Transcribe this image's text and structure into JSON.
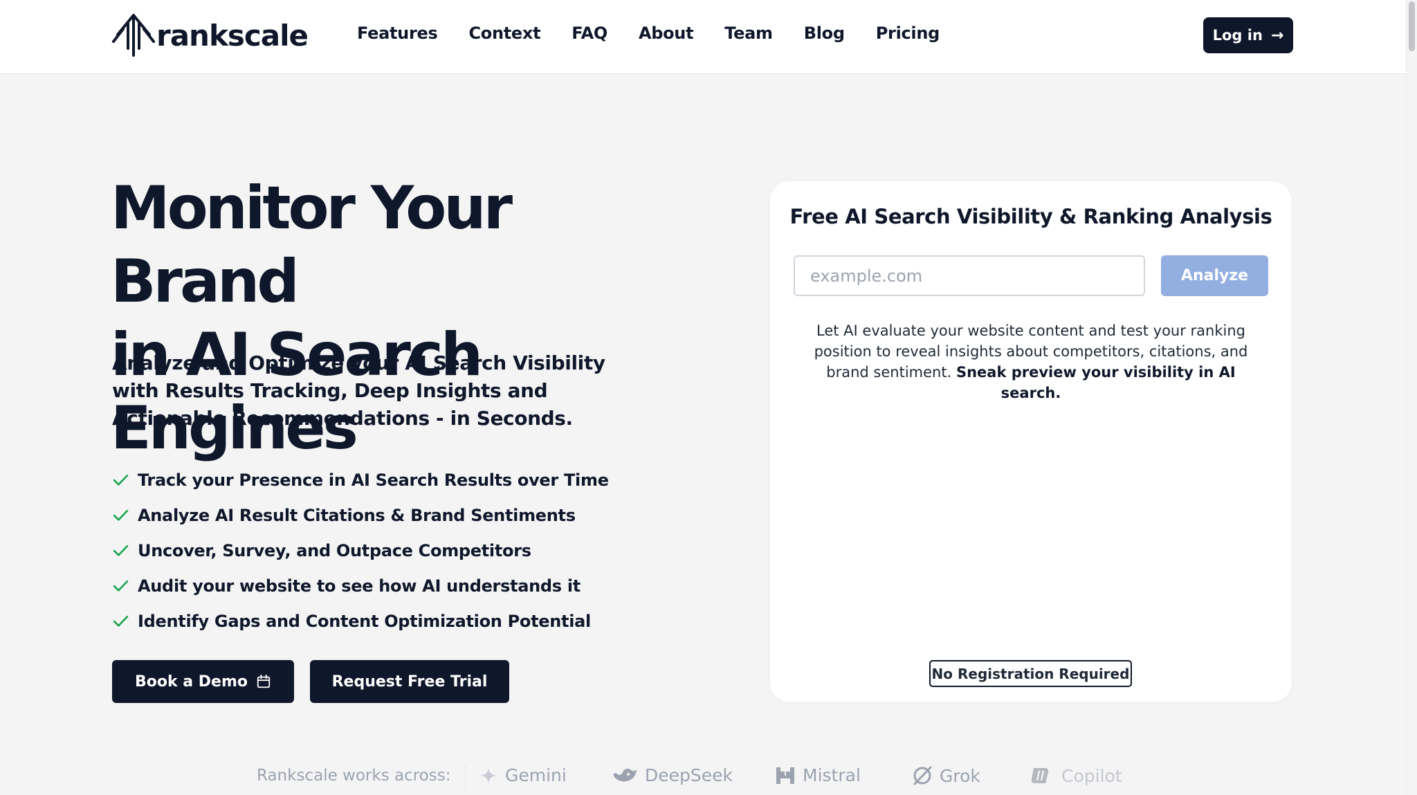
{
  "header": {
    "brand": "rankscale",
    "nav": [
      "Features",
      "Context",
      "FAQ",
      "About",
      "Team",
      "Blog",
      "Pricing"
    ],
    "login_label": "Log in"
  },
  "hero": {
    "title_line1": "Monitor Your Brand",
    "title_line2": "in AI Search Engines",
    "subtitle": "Analyze and Optimize your AI Search Visibility with Results Tracking, Deep Insights and Actionable Recommendations - in Seconds.",
    "features": [
      "Track your Presence in AI Search Results over Time",
      "Analyze AI Result Citations & Brand Sentiments",
      "Uncover, Survey, and Outpace Competitors",
      "Audit your website to see how AI understands it",
      "Identify Gaps and Content Optimization Potential"
    ],
    "demo_label": "Book a Demo",
    "trial_label": "Request Free Trial"
  },
  "card": {
    "title": "Free AI Search Visibility & Ranking Analysis",
    "input_placeholder": "example.com",
    "input_value": "",
    "analyze_label": "Analyze",
    "description": "Let AI evaluate your website content and test your ranking position to reveal insights about competitors, citations, and brand sentiment.",
    "description_bold": "Sneak preview your visibility in AI search.",
    "badge": "No Registration Required"
  },
  "works_across": {
    "label": "Rankscale works across:",
    "partners": [
      {
        "name": "Gemini",
        "icon": "gemini-icon"
      },
      {
        "name": "DeepSeek",
        "icon": "deepseek-icon"
      },
      {
        "name": "Mistral",
        "icon": "mistral-icon"
      },
      {
        "name": "Grok",
        "icon": "grok-icon"
      },
      {
        "name": "Copilot",
        "icon": "copilot-icon"
      }
    ]
  },
  "colors": {
    "primary": "#0f172a",
    "accent_check": "#16a34a",
    "analyze_button": "#93aee0",
    "page_bg": "#f4f4f5"
  }
}
